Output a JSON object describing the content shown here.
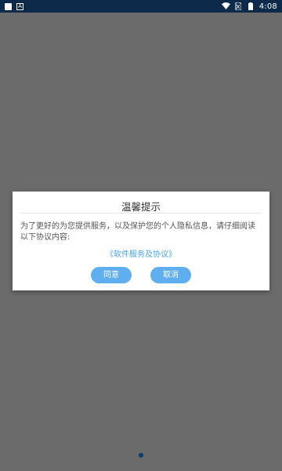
{
  "status_bar": {
    "left_icons": [
      "image-icon",
      "a-icon"
    ],
    "right_icons": [
      "wifi-icon",
      "no-sim-icon",
      "battery-icon"
    ],
    "time": "4:08"
  },
  "dialog": {
    "title": "温馨提示",
    "body": "为了更好的为您提供服务，以及保护您的个人隐私信息，请仔细阅读以下协议内容:",
    "link": "《软件服务及协议》",
    "agree_label": "同意",
    "cancel_label": "取消"
  },
  "colors": {
    "overlay": "#6b6b6b",
    "status_bar": "#0e2a4a",
    "accent": "#5faeef",
    "link": "#4aa3ee"
  }
}
